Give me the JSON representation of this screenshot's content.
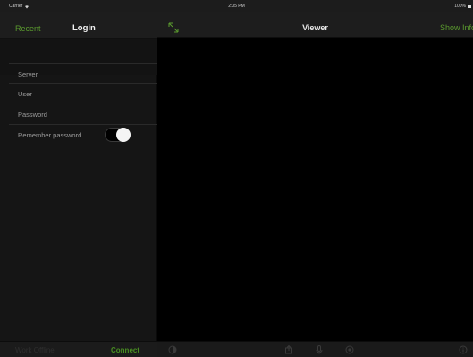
{
  "status_bar": {
    "carrier": "Carrier",
    "time": "2:05 PM",
    "battery": "100%",
    "icons": [
      "wifi-icon",
      "battery-icon"
    ]
  },
  "left_panel": {
    "nav": {
      "recent_label": "Recent",
      "title": "Login"
    },
    "fields": [
      {
        "label": "Server"
      },
      {
        "label": "User"
      },
      {
        "label": "Password"
      }
    ],
    "remember_password": {
      "label": "Remember password",
      "enabled": false
    },
    "bottom": {
      "work_offline_label": "Work Offline",
      "connect_label": "Connect"
    }
  },
  "viewer": {
    "title": "Viewer",
    "show_info_label": "Show Info",
    "toolbar_icons": [
      "brightness-icon",
      "export-icon",
      "microphone-icon",
      "camera-icon",
      "info-icon"
    ]
  },
  "colors": {
    "accent_green": "#5a9a2e",
    "connect_green": "#4a8f22",
    "panel_bg": "#151515",
    "viewer_bg": "#000000"
  }
}
